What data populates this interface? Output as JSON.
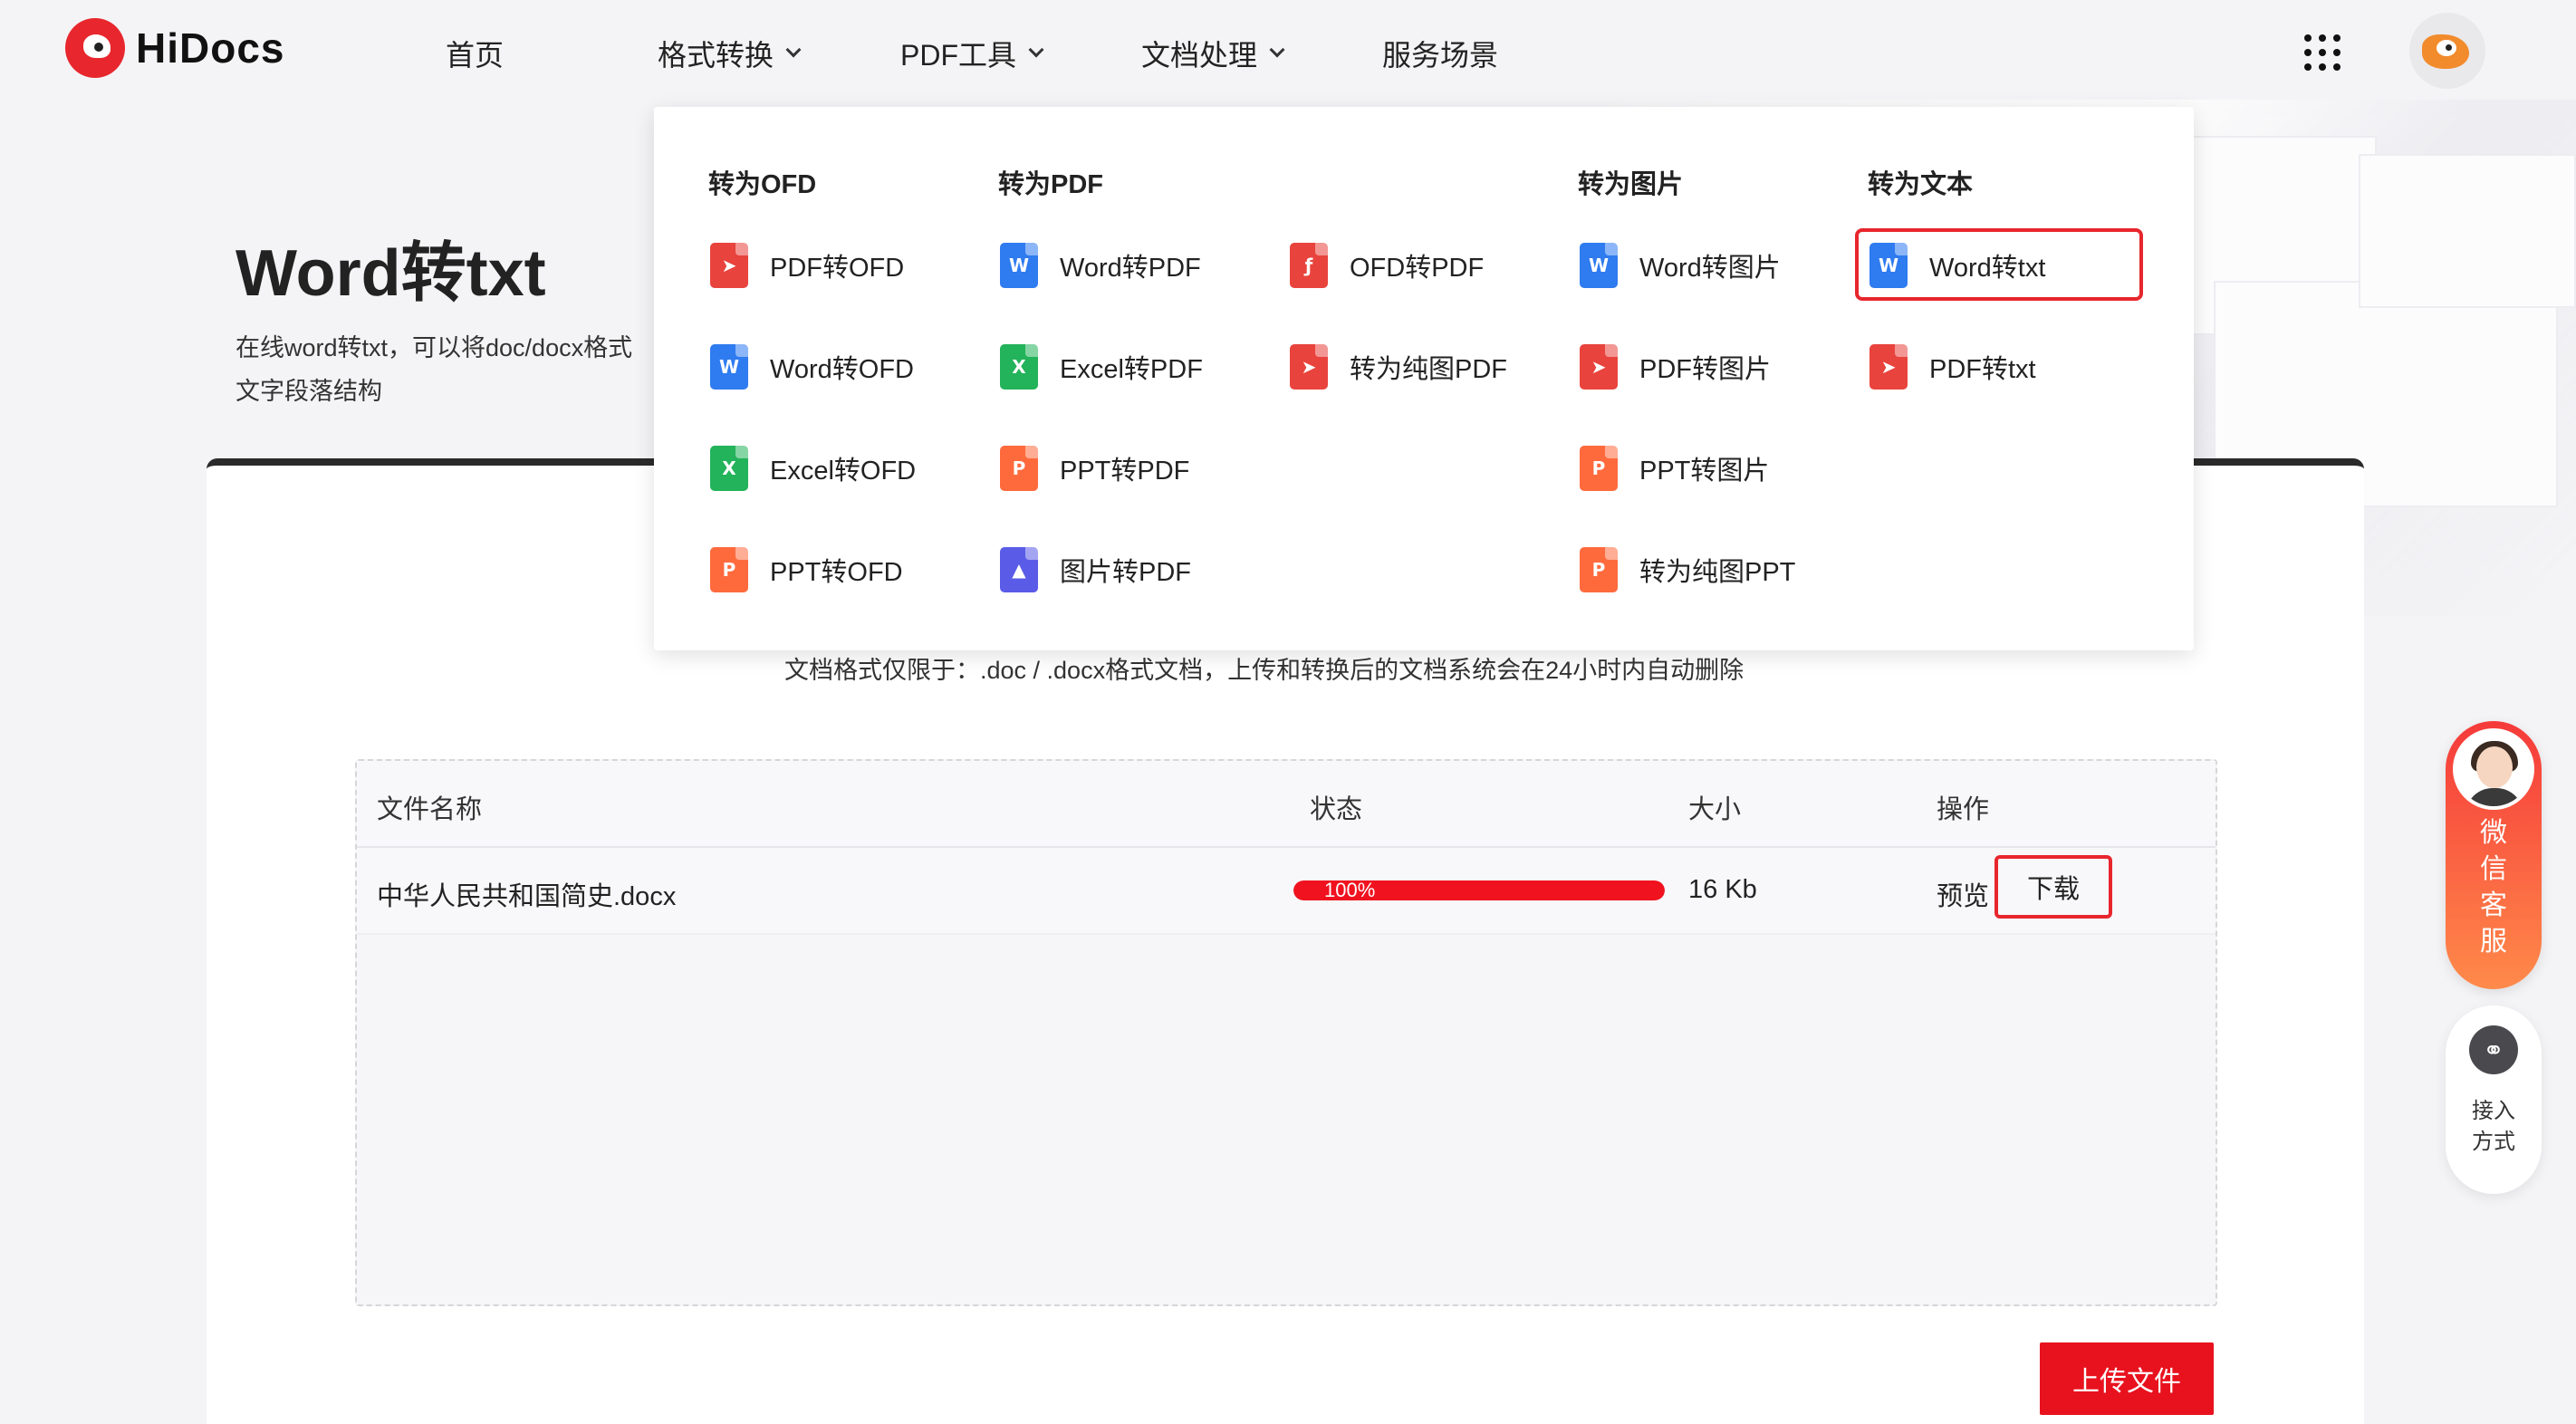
{
  "header": {
    "brand": "HiDocs",
    "nav": [
      {
        "label": "首页",
        "has_dropdown": false
      },
      {
        "label": "格式转换",
        "has_dropdown": true
      },
      {
        "label": "PDF工具",
        "has_dropdown": true
      },
      {
        "label": "文档处理",
        "has_dropdown": true
      },
      {
        "label": "服务场景",
        "has_dropdown": false
      }
    ],
    "apps_icon": "grid-dots-icon",
    "avatar_icon": "fox-avatar-icon"
  },
  "hero": {
    "title": "Word转txt",
    "desc_line1": "在线word转txt，可以将doc/docx格式",
    "desc_line2": "文字段落结构"
  },
  "dropdown": {
    "columns": [
      {
        "heading": "转为OFD",
        "items": [
          {
            "label": "PDF转OFD",
            "icon": "pdf"
          },
          {
            "label": "Word转OFD",
            "icon": "word"
          },
          {
            "label": "Excel转OFD",
            "icon": "excel"
          },
          {
            "label": "PPT转OFD",
            "icon": "ppt"
          }
        ]
      },
      {
        "heading": "转为PDF",
        "items": [
          {
            "label": "Word转PDF",
            "icon": "word"
          },
          {
            "label": "Excel转PDF",
            "icon": "excel"
          },
          {
            "label": "PPT转PDF",
            "icon": "ppt"
          },
          {
            "label": "图片转PDF",
            "icon": "image"
          }
        ]
      },
      {
        "heading": "",
        "items": [
          {
            "label": "OFD转PDF",
            "icon": "ofd"
          },
          {
            "label": "转为纯图PDF",
            "icon": "pdf"
          }
        ]
      },
      {
        "heading": "转为图片",
        "items": [
          {
            "label": "Word转图片",
            "icon": "word"
          },
          {
            "label": "PDF转图片",
            "icon": "pdf"
          },
          {
            "label": "PPT转图片",
            "icon": "ppt"
          },
          {
            "label": "转为纯图PPT",
            "icon": "ppt"
          }
        ]
      },
      {
        "heading": "转为文本",
        "items": [
          {
            "label": "Word转txt",
            "icon": "word",
            "selected": true
          },
          {
            "label": "PDF转txt",
            "icon": "pdf"
          }
        ]
      }
    ]
  },
  "main": {
    "limits_text": "文档格式仅限于：.doc / .docx格式文档，上传和转换后的文档系统会在24小时内自动删除",
    "table": {
      "headers": [
        "文件名称",
        "状态",
        "大小",
        "操作"
      ],
      "rows": [
        {
          "name": "中华人民共和国简史.docx",
          "progress": 100,
          "progress_label": "100%",
          "size": "16 Kb",
          "preview": "预览",
          "download": "下载"
        }
      ]
    },
    "upload_label": "上传文件"
  },
  "floating": {
    "service_label": [
      "微",
      "信",
      "客",
      "服"
    ],
    "connect_label": [
      "接入",
      "方式"
    ]
  },
  "colors": {
    "accent": "#e8262d",
    "progress": "#f0121e"
  }
}
